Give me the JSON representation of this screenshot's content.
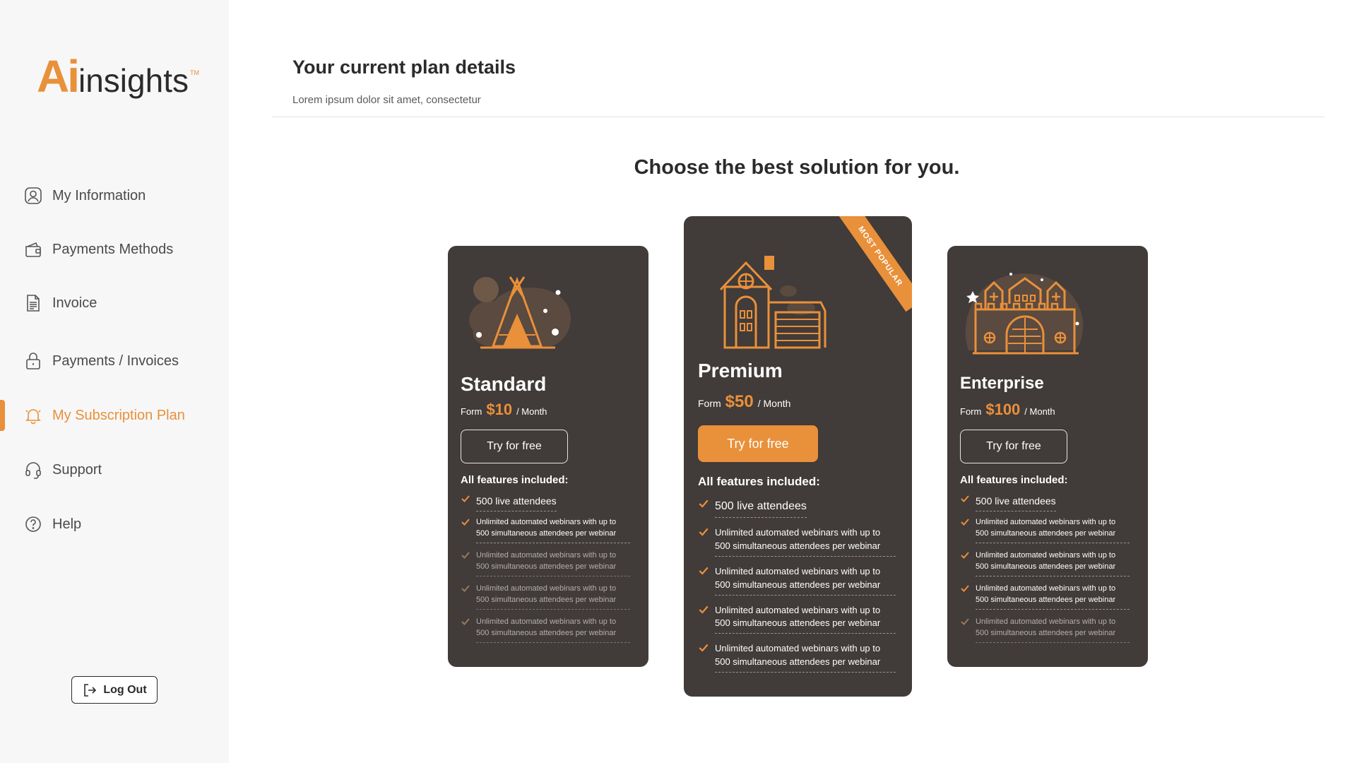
{
  "brand": {
    "ai": "Ai",
    "insights": "insights",
    "tm": "TM",
    "accent": "#e9903a"
  },
  "sidebar": {
    "items": [
      {
        "label": "My Information",
        "icon": "user-icon"
      },
      {
        "label": "Payments Methods",
        "icon": "wallet-icon"
      },
      {
        "label": "Invoice",
        "icon": "document-icon"
      },
      {
        "label": "Payments / Invoices",
        "icon": "lock-icon"
      },
      {
        "label": "My Subscription Plan",
        "icon": "bell-icon",
        "active": true
      },
      {
        "label": "Support",
        "icon": "headset-icon"
      },
      {
        "label": "Help",
        "icon": "help-icon"
      }
    ],
    "logout_label": "Log Out"
  },
  "header": {
    "title": "Your current plan details",
    "subtitle": "Lorem ipsum dolor sit amet, consectetur"
  },
  "plans_title": "Choose the best solution for you.",
  "plans": [
    {
      "name": "Standard",
      "from": "Form",
      "price": "$10",
      "per": "/ Month",
      "cta": "Try for free",
      "features_title": "All features included:",
      "features": [
        {
          "text": "500 live attendees",
          "enabled": true
        },
        {
          "text": "Unlimited automated webinars with up to 500 simultaneous attendees per webinar",
          "enabled": true
        },
        {
          "text": "Unlimited automated webinars with up to 500 simultaneous attendees per webinar",
          "enabled": false
        },
        {
          "text": "Unlimited automated webinars with up to 500 simultaneous attendees per webinar",
          "enabled": false
        },
        {
          "text": "Unlimited automated webinars with up to 500 simultaneous attendees per webinar",
          "enabled": false
        }
      ]
    },
    {
      "name": "Premium",
      "from": "Form",
      "price": "$50",
      "per": "/ Month",
      "cta": "Try for free",
      "badge": "MOST POPULAR",
      "features_title": "All features included:",
      "features": [
        {
          "text": "500 live attendees",
          "enabled": true
        },
        {
          "text": "Unlimited automated webinars with up to 500 simultaneous attendees per webinar",
          "enabled": true
        },
        {
          "text": "Unlimited automated webinars with up to 500 simultaneous attendees per webinar",
          "enabled": true
        },
        {
          "text": "Unlimited automated webinars with up to 500 simultaneous attendees per webinar",
          "enabled": true
        },
        {
          "text": "Unlimited automated webinars with up to 500 simultaneous attendees per webinar",
          "enabled": true
        }
      ]
    },
    {
      "name": "Enterprise",
      "from": "Form",
      "price": "$100",
      "per": "/ Month",
      "cta": "Try for free",
      "features_title": "All features included:",
      "features": [
        {
          "text": "500 live attendees",
          "enabled": true
        },
        {
          "text": "Unlimited automated webinars with up to 500 simultaneous attendees per webinar",
          "enabled": true
        },
        {
          "text": "Unlimited automated webinars with up to 500 simultaneous attendees per webinar",
          "enabled": true
        },
        {
          "text": "Unlimited automated webinars with up to 500 simultaneous attendees per webinar",
          "enabled": true
        },
        {
          "text": "Unlimited automated webinars with up to 500 simultaneous attendees per webinar",
          "enabled": false
        }
      ]
    }
  ]
}
